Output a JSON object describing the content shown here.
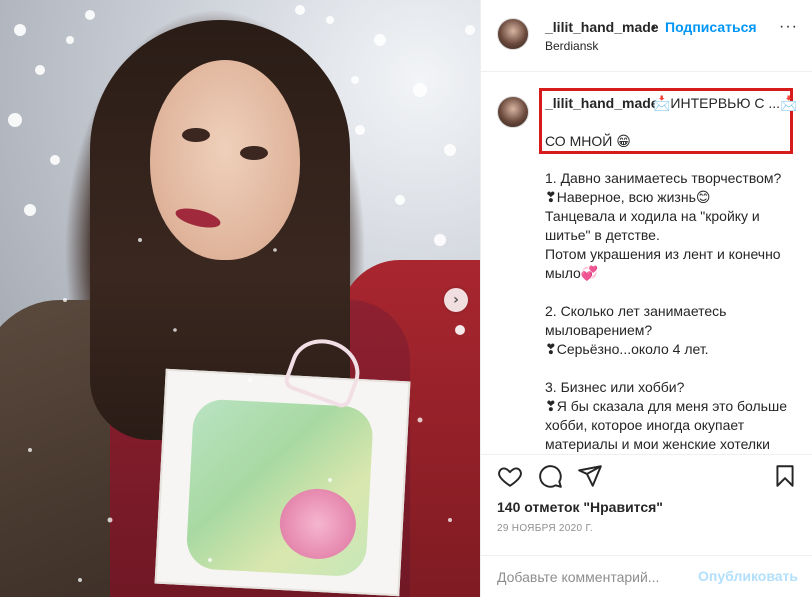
{
  "post": {
    "username": "_lilit_hand_made",
    "dot": "•",
    "follow_label": "Подписаться",
    "location": "Berdiansk",
    "more_label": "···"
  },
  "caption": {
    "username": "_lilit_hand_made",
    "headline": "📩ИНТЕРВЬЮ С ...📩",
    "line2": "СО МНОЙ 😁",
    "body": "1. Давно занимаетесь творчеством?\n❣Наверное, всю жизнь😊\nТанцевала и ходила на \"кройку и шитье\" в детстве.\nПотом украшения из лент и конечно мыло💞\n\n2. Сколько лет занимаетесь мыловарением?\n❣Серьёзно...около 4 лет.\n\n3. Бизнес или хобби?\n❣Я бы сказала для меня это больше хобби, которое иногда окупает материалы и мои женские хотелки\n😁"
  },
  "actions": {
    "likes": "140 отметок \"Нравится\"",
    "date": "29 НОЯБРЯ 2020 Г."
  },
  "comment": {
    "placeholder": "Добавьте комментарий...",
    "post_label": "Опубликовать"
  },
  "photo": {
    "next_arrow": "›"
  },
  "colors": {
    "link_blue": "#0095f6",
    "highlight_red": "#d71a1a",
    "muted": "#8e8e8e"
  }
}
